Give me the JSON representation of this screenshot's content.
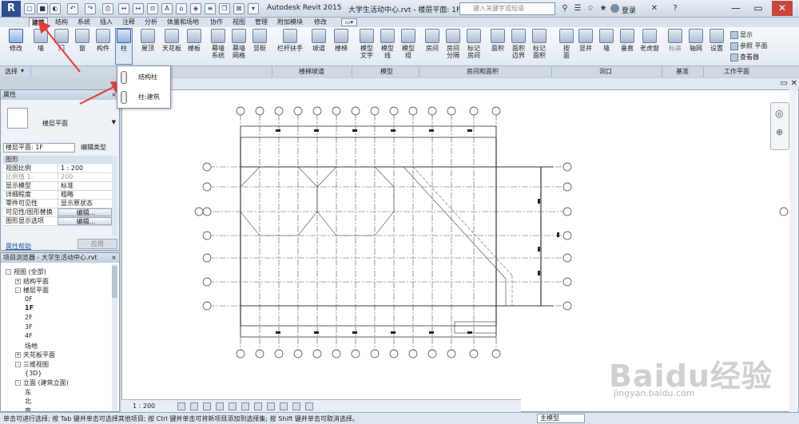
{
  "app": {
    "title": "Autodesk Revit 2015",
    "document": "大学生活动中心.rvt - 楼层平面: 1F",
    "search_placeholder": "键入关键字或短语",
    "login": "登录",
    "logo": "R"
  },
  "tabs": [
    "建筑",
    "结构",
    "系统",
    "插入",
    "注释",
    "分析",
    "体量和场地",
    "协作",
    "视图",
    "管理",
    "附加模块",
    "修改"
  ],
  "ribbon": {
    "buttons": [
      {
        "label": "修改"
      },
      {
        "label": "墙"
      },
      {
        "label": "门"
      },
      {
        "label": "窗"
      },
      {
        "label": "构件"
      },
      {
        "label": "柱"
      },
      {
        "label": "屋顶"
      },
      {
        "label": "天花板"
      },
      {
        "label": "楼板"
      },
      {
        "label": "幕墙\n系统"
      },
      {
        "label": "幕墙\n网格"
      },
      {
        "label": "竖梃"
      },
      {
        "label": "栏杆扶手"
      },
      {
        "label": "坡道"
      },
      {
        "label": "楼梯"
      },
      {
        "label": "模型\n文字"
      },
      {
        "label": "模型\n线"
      },
      {
        "label": "模型\n组"
      },
      {
        "label": "房间"
      },
      {
        "label": "房间\n分隔"
      },
      {
        "label": "标记\n房间"
      },
      {
        "label": "面积"
      },
      {
        "label": "面积\n边界"
      },
      {
        "label": "标记\n面积"
      },
      {
        "label": "按\n面"
      },
      {
        "label": "竖井"
      },
      {
        "label": "墙"
      },
      {
        "label": "垂直"
      },
      {
        "label": "老虎窗"
      },
      {
        "label": "标高"
      },
      {
        "label": "轴网"
      },
      {
        "label": "设置"
      }
    ],
    "workplane_items": [
      "显示",
      "参照 平面",
      "查看器"
    ],
    "panels": [
      "选择",
      "楼梯坡道",
      "模型",
      "房间和面积",
      "洞口",
      "基准",
      "工作平面"
    ]
  },
  "column_dropdown": {
    "items": [
      "结构柱",
      "柱:建筑"
    ]
  },
  "properties": {
    "title": "属性",
    "close": "×",
    "type_name": "楼层平面",
    "filter": "楼层平面: 1F",
    "edit_type": "编辑类型",
    "group": "图形",
    "rows": [
      {
        "key": "视图比例",
        "value": "1 : 200"
      },
      {
        "key": "比例值 1:",
        "value": "200"
      },
      {
        "key": "显示模型",
        "value": "标准"
      },
      {
        "key": "详细程度",
        "value": "粗略"
      },
      {
        "key": "零件可见性",
        "value": "显示原状态"
      },
      {
        "key": "可见性/图形替换",
        "value": "编辑..."
      },
      {
        "key": "图形显示选项",
        "value": "编辑..."
      }
    ],
    "help": "属性帮助",
    "apply": "应用"
  },
  "browser": {
    "title": "项目浏览器 - 大学生活动中心.rvt",
    "close": "×",
    "items": [
      {
        "label": "视图 (全部)",
        "level": 0,
        "toggle": "-"
      },
      {
        "label": "结构平面",
        "level": 1,
        "toggle": "+"
      },
      {
        "label": "楼层平面",
        "level": 1,
        "toggle": "-"
      },
      {
        "label": "0F",
        "level": 2
      },
      {
        "label": "1F",
        "level": 2,
        "bold": true
      },
      {
        "label": "2F",
        "level": 2
      },
      {
        "label": "3F",
        "level": 2
      },
      {
        "label": "4F",
        "level": 2
      },
      {
        "label": "场地",
        "level": 2
      },
      {
        "label": "天花板平面",
        "level": 1,
        "toggle": "+"
      },
      {
        "label": "三维视图",
        "level": 1,
        "toggle": "-"
      },
      {
        "label": "{3D}",
        "level": 2
      },
      {
        "label": "立面 (建筑立面)",
        "level": 1,
        "toggle": "-"
      },
      {
        "label": "东",
        "level": 2
      },
      {
        "label": "北",
        "level": 2
      },
      {
        "label": "南",
        "level": 2
      }
    ]
  },
  "viewbar": {
    "scale": "1 : 200"
  },
  "status": {
    "text": "单击可进行选择; 按 Tab 键并单击可选择其他项目; 按 Ctrl 键并单击可将新项目添加到选择集; 按 Shift 键并单击可取消选择。",
    "model": "主模型"
  },
  "watermark": {
    "main": "Baidu经验",
    "sub": "jingyan.baidu.com"
  },
  "colors": {
    "accent": "#2f4f8f",
    "arrow": "#e23b3b",
    "close": "#c9463d"
  }
}
